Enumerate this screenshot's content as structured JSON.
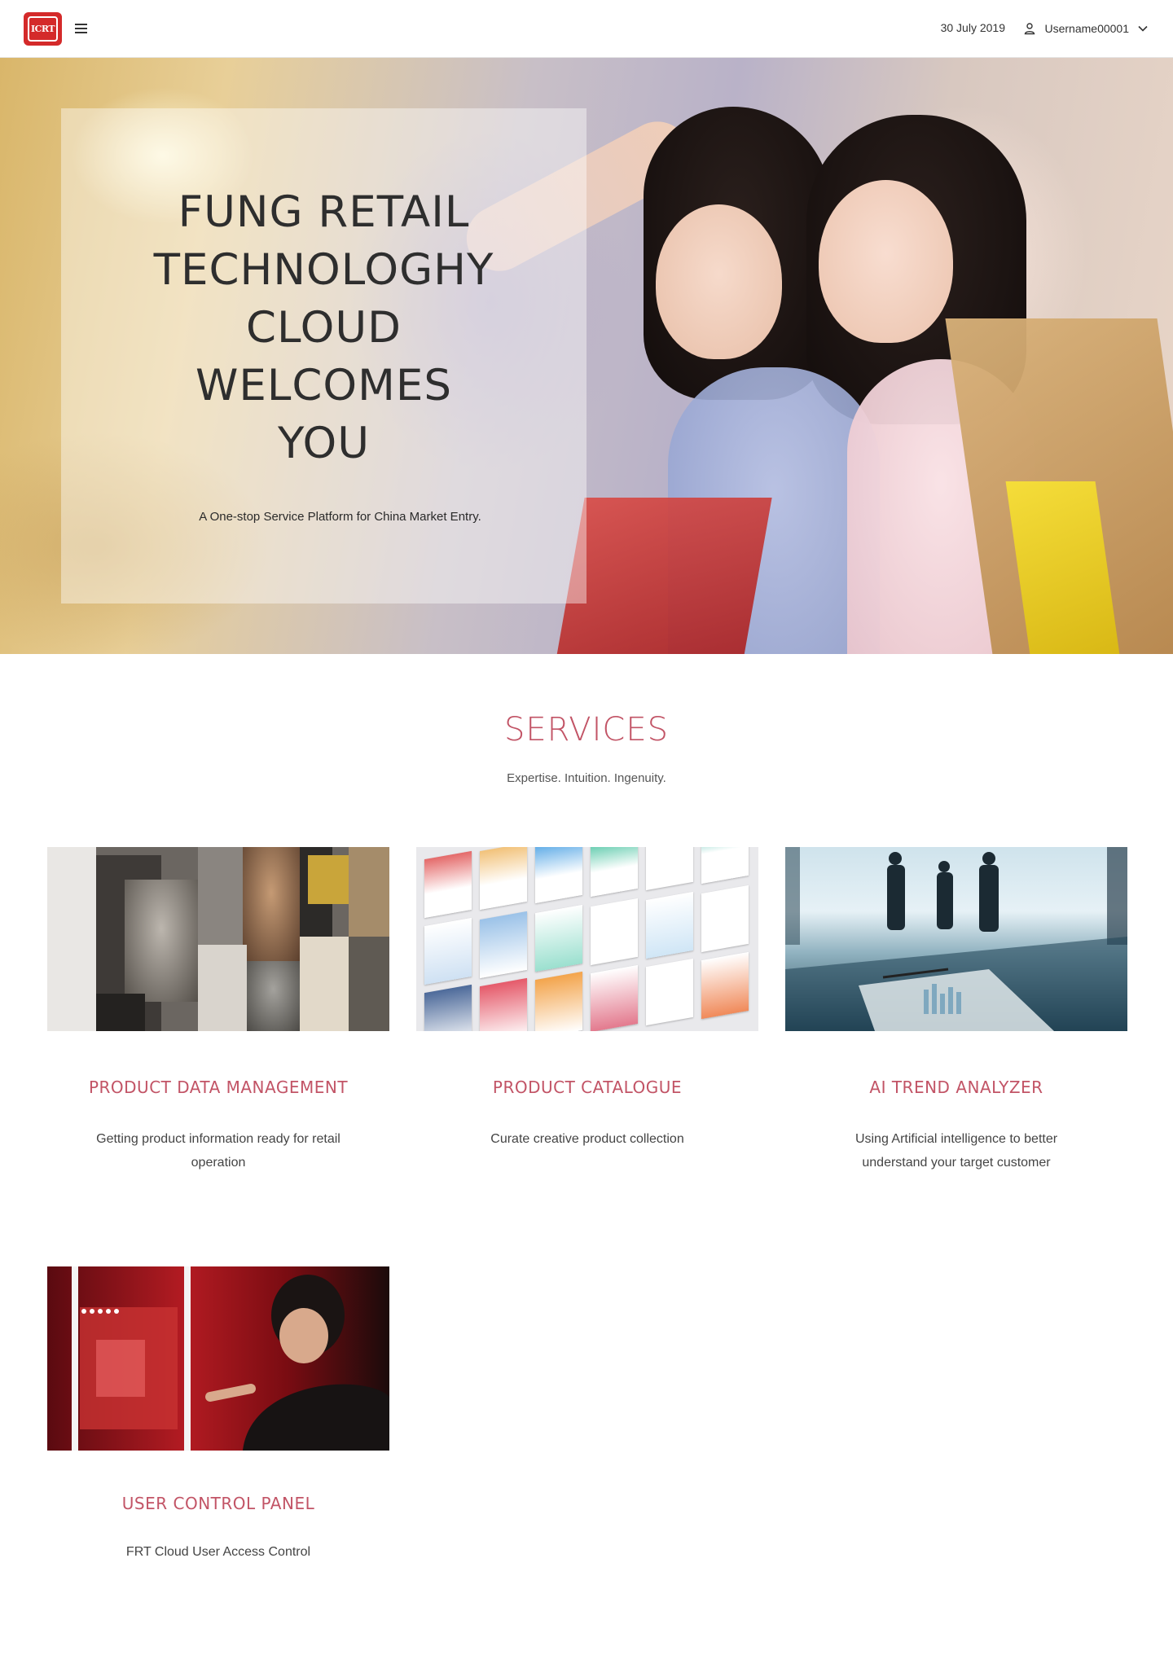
{
  "header": {
    "logo_text": "ICRT",
    "date": "30 July 2019",
    "username": "Username00001"
  },
  "hero": {
    "title_lines": [
      "FUNG RETAIL",
      "TECHNOLOGHY",
      "CLOUD",
      "WELCOMES",
      "YOU"
    ],
    "subtitle": "A One-stop Service Platform for China Market Entry."
  },
  "services": {
    "title": "SERVICES",
    "subtitle": "Expertise. Intuition. Ingenuity.",
    "items": [
      {
        "name": "PRODUCT DATA  MANAGEMENT",
        "description": "Getting product information ready for retail operation"
      },
      {
        "name": "PRODUCT CATALOGUE",
        "description": "Curate creative product collection"
      },
      {
        "name": "AI TREND ANALYZER",
        "description": "Using Artificial intelligence to better understand your target customer"
      },
      {
        "name": "USER CONTROL PANEL",
        "description": "FRT Cloud User Access Control"
      }
    ]
  },
  "colors": {
    "accent": "#c25466",
    "logo_red": "#d42a2a"
  },
  "icons": {
    "menu": "hamburger-icon",
    "user": "user-icon",
    "dropdown": "chevron-down-icon"
  }
}
